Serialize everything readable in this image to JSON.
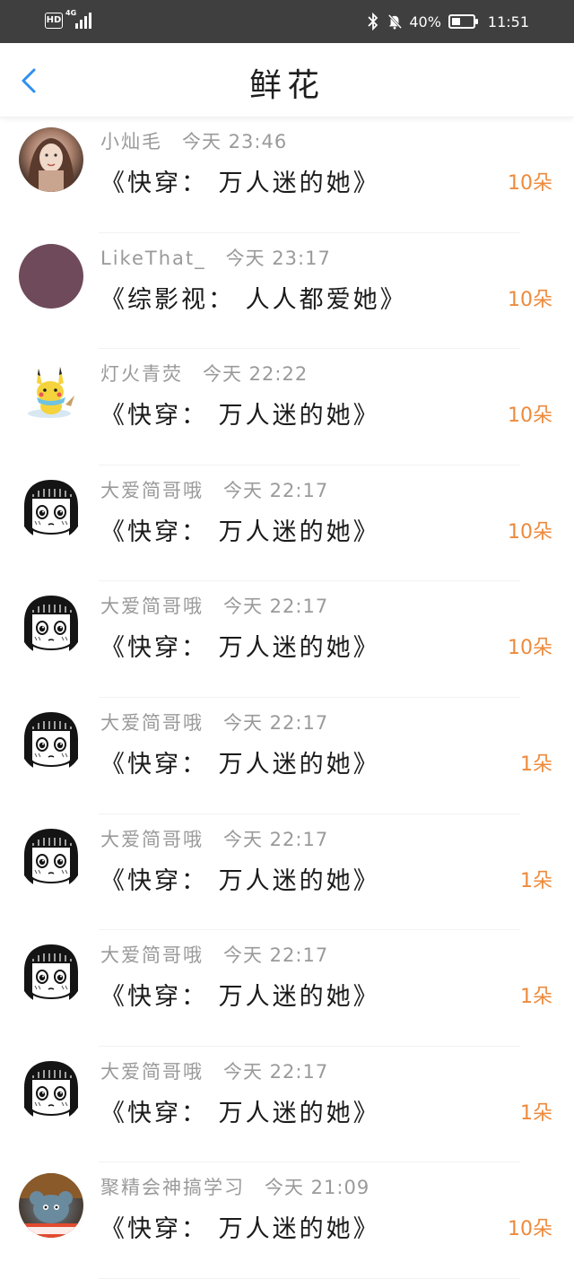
{
  "status_bar": {
    "hd": "HD",
    "network": "4G",
    "battery_percent": "40%",
    "battery_level": 0.4,
    "time": "11:51"
  },
  "header": {
    "title": "鲜花",
    "back_icon": "chevron-left-icon"
  },
  "colors": {
    "accent_blue": "#2f8ff0",
    "amount_orange": "#ee8a3c",
    "meta_gray": "#9a9a9a"
  },
  "gifts": [
    {
      "user": "小灿毛",
      "time": "今天 23:46",
      "book": "《快穿： 万人迷的她》",
      "amount": "10朵",
      "avatar": "photo-avatar"
    },
    {
      "user": "LikeThat_",
      "time": "今天 23:17",
      "book": "《综影视： 人人都爱她》",
      "amount": "10朵",
      "avatar": "plain-avatar"
    },
    {
      "user": "灯火青荧",
      "time": "今天 22:22",
      "book": "《快穿： 万人迷的她》",
      "amount": "10朵",
      "avatar": "pikachu-avatar"
    },
    {
      "user": "大爱简哥哦",
      "time": "今天 22:17",
      "book": "《快穿： 万人迷的她》",
      "amount": "10朵",
      "avatar": "manga-girl-avatar"
    },
    {
      "user": "大爱简哥哦",
      "time": "今天 22:17",
      "book": "《快穿： 万人迷的她》",
      "amount": "10朵",
      "avatar": "manga-girl-avatar"
    },
    {
      "user": "大爱简哥哦",
      "time": "今天 22:17",
      "book": "《快穿： 万人迷的她》",
      "amount": "1朵",
      "avatar": "manga-girl-avatar"
    },
    {
      "user": "大爱简哥哦",
      "time": "今天 22:17",
      "book": "《快穿： 万人迷的她》",
      "amount": "1朵",
      "avatar": "manga-girl-avatar"
    },
    {
      "user": "大爱简哥哦",
      "time": "今天 22:17",
      "book": "《快穿： 万人迷的她》",
      "amount": "1朵",
      "avatar": "manga-girl-avatar"
    },
    {
      "user": "大爱简哥哦",
      "time": "今天 22:17",
      "book": "《快穿： 万人迷的她》",
      "amount": "1朵",
      "avatar": "manga-girl-avatar"
    },
    {
      "user": "聚精会神搞学习",
      "time": "今天 21:09",
      "book": "《快穿： 万人迷的她》",
      "amount": "10朵",
      "avatar": "cartoon-mouse-avatar"
    }
  ]
}
